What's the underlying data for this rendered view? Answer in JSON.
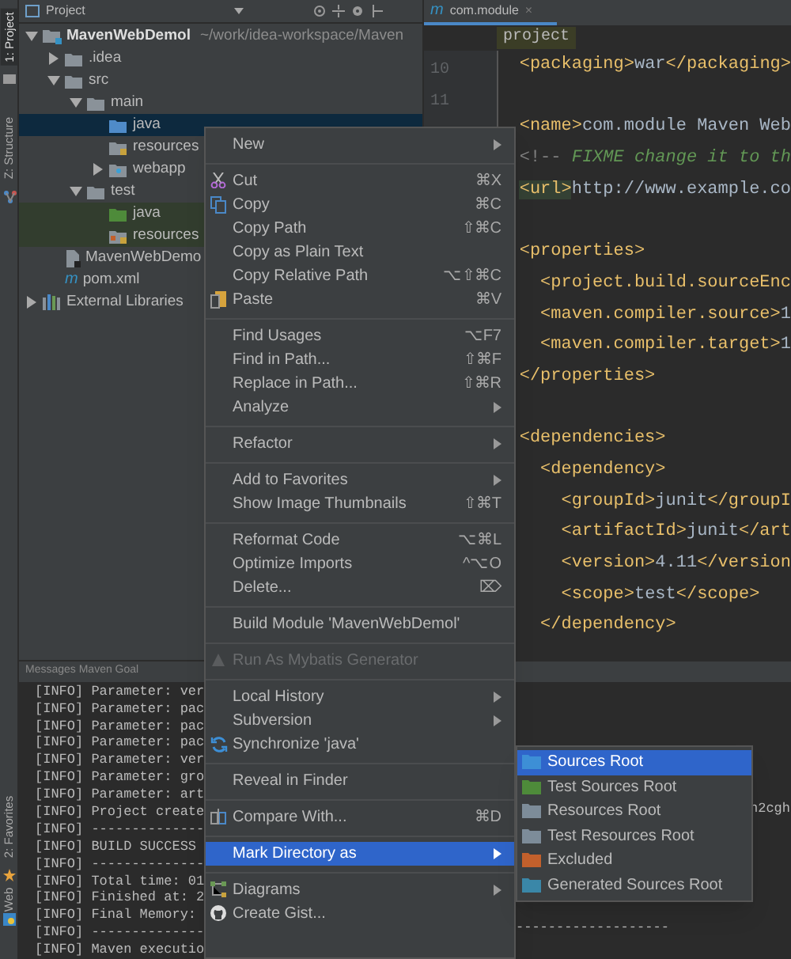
{
  "tool_strip": [
    {
      "label": "1: Project",
      "selected": true
    },
    {
      "label": "Z: Structure",
      "selected": false
    },
    {
      "label": "2: Favorites",
      "selected": false
    },
    {
      "label": "Web",
      "selected": false
    }
  ],
  "project_panel": {
    "title": "Project",
    "tree": [
      {
        "name": "MavenWebDemol",
        "path": "~/work/idea-workspace/Maven",
        "kind": "module",
        "expanded": true,
        "selected": false,
        "children": [
          {
            "name": ".idea",
            "kind": "folder",
            "expanded": false,
            "selected": false
          },
          {
            "name": "src",
            "kind": "folder",
            "expanded": true,
            "selected": false,
            "children": [
              {
                "name": "main",
                "kind": "folder",
                "expanded": true,
                "selected": false,
                "children": [
                  {
                    "name": "java",
                    "kind": "source",
                    "selected": true
                  },
                  {
                    "name": "resources",
                    "kind": "resources",
                    "selected": false
                  },
                  {
                    "name": "webapp",
                    "kind": "web",
                    "expanded": false,
                    "selected": false
                  }
                ]
              },
              {
                "name": "test",
                "kind": "folder",
                "expanded": true,
                "selected": false,
                "children": [
                  {
                    "name": "java",
                    "kind": "test-source",
                    "selected": false
                  },
                  {
                    "name": "resources",
                    "kind": "test-resources",
                    "selected": false
                  }
                ]
              }
            ]
          },
          {
            "name": "MavenWebDemo",
            "kind": "iml",
            "selected": false
          },
          {
            "name": "pom.xml",
            "kind": "pom",
            "icon_text": "m",
            "selected": false
          }
        ]
      },
      {
        "name": "External Libraries",
        "kind": "libraries",
        "expanded": false,
        "selected": false
      }
    ]
  },
  "editor": {
    "tab": {
      "icon_text": "m",
      "label": "com.module",
      "close": "×"
    },
    "breadcrumb": "project",
    "lines": [
      {
        "number": "10",
        "kind": "code",
        "text": "<packaging>war</packaging>"
      },
      {
        "number": "11",
        "kind": "blank"
      },
      {
        "kind": "code",
        "text": "<name>com.module Maven Web"
      },
      {
        "kind": "comment",
        "text": "<!-- FIXME change it to th"
      },
      {
        "kind": "code",
        "text": "<url>http://www.example.co",
        "match_highlight": true
      },
      {
        "kind": "blank"
      },
      {
        "kind": "code",
        "text": "<properties>"
      },
      {
        "kind": "code",
        "text": "  <project.build.sourceEnc"
      },
      {
        "kind": "code",
        "text": "  <maven.compiler.source>1"
      },
      {
        "kind": "code",
        "text": "  <maven.compiler.target>1"
      },
      {
        "kind": "code",
        "text": "</properties>"
      },
      {
        "kind": "blank"
      },
      {
        "kind": "code",
        "text": "<dependencies>"
      },
      {
        "kind": "code",
        "text": "  <dependency>"
      },
      {
        "kind": "code",
        "text": "    <groupId>junit</groupI"
      },
      {
        "kind": "code",
        "text": "    <artifactId>junit</art"
      },
      {
        "kind": "code",
        "text": "    <version>4.11</version"
      },
      {
        "kind": "code",
        "text": "    <scope>test</scope>"
      },
      {
        "kind": "code",
        "text": "  </dependency>"
      }
    ]
  },
  "bottom_panel": {
    "title": "Messages Maven Goal",
    "console": [
      "[INFO] Parameter: ver",
      "[INFO] Parameter: pac",
      "[INFO] Parameter: pac",
      "[INFO] Parameter: pac",
      "[INFO] Parameter: ver",
      "[INFO] Parameter: gro",
      "[INFO] Parameter: art",
      "[INFO] Project create",
      "[INFO] --------------",
      "[INFO] BUILD SUCCESS",
      "[INFO] --------------",
      "[INFO] Total time: 01",
      "[INFO] Finished at: 2",
      "[INFO] Final Memory:",
      "[INFO] --------------",
      "[INFO] Maven executio"
    ],
    "console_fragments": [
      "h2cgh",
      "-------------------"
    ]
  },
  "context_menu": {
    "groups": [
      [
        {
          "label": "New",
          "submenu": true,
          "selected": false,
          "disabled": false
        }
      ],
      [
        {
          "label": "Cut",
          "shortcut": "⌘X",
          "selected": false,
          "disabled": false
        },
        {
          "label": "Copy",
          "shortcut": "⌘C",
          "selected": false,
          "disabled": false
        },
        {
          "label": "Copy Path",
          "shortcut": "⇧⌘C",
          "selected": false,
          "disabled": false
        },
        {
          "label": "Copy as Plain Text",
          "selected": false,
          "disabled": false
        },
        {
          "label": "Copy Relative Path",
          "shortcut": "⌥⇧⌘C",
          "selected": false,
          "disabled": false
        },
        {
          "label": "Paste",
          "shortcut": "⌘V",
          "selected": false,
          "disabled": false
        }
      ],
      [
        {
          "label": "Find Usages",
          "shortcut": "⌥F7",
          "selected": false,
          "disabled": false
        },
        {
          "label": "Find in Path...",
          "shortcut": "⇧⌘F",
          "selected": false,
          "disabled": false
        },
        {
          "label": "Replace in Path...",
          "shortcut": "⇧⌘R",
          "selected": false,
          "disabled": false
        },
        {
          "label": "Analyze",
          "submenu": true,
          "selected": false,
          "disabled": false
        }
      ],
      [
        {
          "label": "Refactor",
          "submenu": true,
          "selected": false,
          "disabled": false
        }
      ],
      [
        {
          "label": "Add to Favorites",
          "submenu": true,
          "selected": false,
          "disabled": false
        },
        {
          "label": "Show Image Thumbnails",
          "shortcut": "⇧⌘T",
          "selected": false,
          "disabled": false
        }
      ],
      [
        {
          "label": "Reformat Code",
          "shortcut": "⌥⌘L",
          "selected": false,
          "disabled": false
        },
        {
          "label": "Optimize Imports",
          "shortcut": "^⌥O",
          "selected": false,
          "disabled": false
        },
        {
          "label": "Delete...",
          "shortcut": "⌦",
          "selected": false,
          "disabled": false
        }
      ],
      [
        {
          "label": "Build Module 'MavenWebDemol'",
          "selected": false,
          "disabled": false
        }
      ],
      [
        {
          "label": "Run As Mybatis Generator",
          "selected": false,
          "disabled": true
        }
      ],
      [
        {
          "label": "Local History",
          "submenu": true,
          "selected": false,
          "disabled": false
        },
        {
          "label": "Subversion",
          "submenu": true,
          "selected": false,
          "disabled": false
        },
        {
          "label": "Synchronize 'java'",
          "selected": false,
          "disabled": false
        }
      ],
      [
        {
          "label": "Reveal in Finder",
          "selected": false,
          "disabled": false
        }
      ],
      [
        {
          "label": "Compare With...",
          "shortcut": "⌘D",
          "selected": false,
          "disabled": false
        }
      ],
      [
        {
          "label": "Mark Directory as",
          "submenu": true,
          "selected": true,
          "disabled": false
        }
      ],
      [
        {
          "label": "Diagrams",
          "submenu": true,
          "selected": false,
          "disabled": false
        },
        {
          "label": "Create Gist...",
          "selected": false,
          "disabled": false
        }
      ]
    ]
  },
  "submenu": [
    {
      "label": "Sources Root",
      "color": "#3d8fd6",
      "selected": true
    },
    {
      "label": "Test Sources Root",
      "color": "#4e8b3a",
      "selected": false
    },
    {
      "label": "Resources Root",
      "color": "#7d8c99",
      "selected": false
    },
    {
      "label": "Test Resources Root",
      "color": "#7d8c99",
      "selected": false
    },
    {
      "label": "Excluded",
      "color": "#c2602c",
      "selected": false
    },
    {
      "label": "Generated Sources Root",
      "color": "#3a87a8",
      "selected": false
    }
  ]
}
